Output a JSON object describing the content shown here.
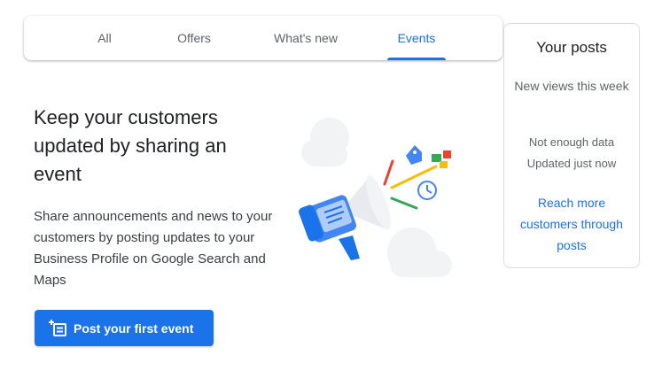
{
  "tabs": [
    {
      "label": "All",
      "active": false
    },
    {
      "label": "Offers",
      "active": false
    },
    {
      "label": "What's new",
      "active": false
    },
    {
      "label": "Events",
      "active": true
    }
  ],
  "main": {
    "headline": "Keep your customers updated by sharing an event",
    "description": "Share announcements and news to your customers by posting updates to your Business Profile on Google Search and Maps",
    "button_label": "Post your first event",
    "button_icon": "add-post-icon",
    "illustration": "megaphone-illustration"
  },
  "posts_card": {
    "title": "Your posts",
    "subtitle": "New views this week",
    "status_line1": "Not enough data",
    "status_line2": "Updated just now",
    "link": "Reach more customers through posts"
  },
  "colors": {
    "accent": "#1a73e8",
    "text": "#202124",
    "muted": "#5f6368",
    "border": "#dadce0"
  }
}
